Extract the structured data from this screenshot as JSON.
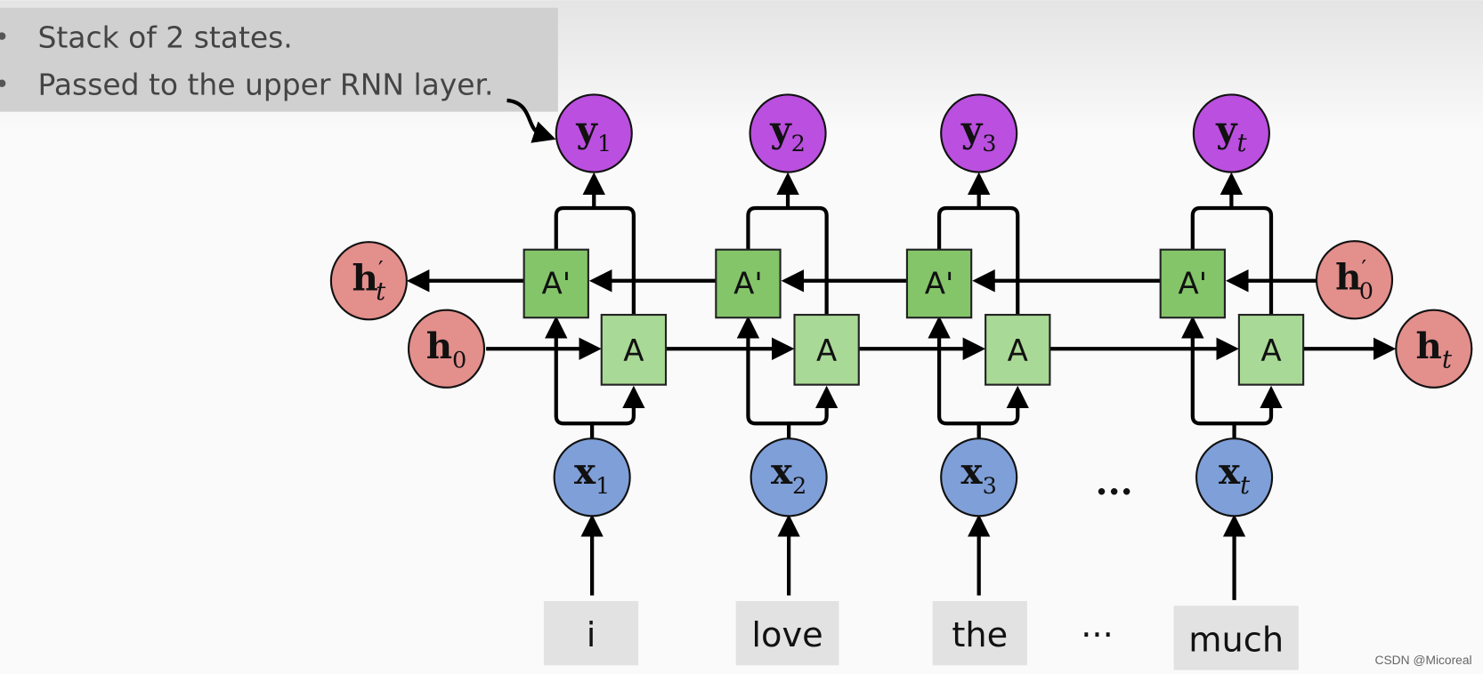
{
  "bullets": [
    "Stack of 2 states.",
    "Passed to the upper RNN layer."
  ],
  "outputs": [
    {
      "sym": "y",
      "sub": "1"
    },
    {
      "sym": "y",
      "sub": "2"
    },
    {
      "sym": "y",
      "sub": "3"
    },
    {
      "sym": "y",
      "sub": "t"
    }
  ],
  "inputs": [
    {
      "sym": "x",
      "sub": "1"
    },
    {
      "sym": "x",
      "sub": "2"
    },
    {
      "sym": "x",
      "sub": "3"
    },
    {
      "sym": "x",
      "sub": "t"
    }
  ],
  "backward_cell_label": "A'",
  "forward_cell_label": "A",
  "states": {
    "h_t_prime": {
      "sym": "h",
      "prime": "′",
      "sub": "t"
    },
    "h_0": {
      "sym": "h",
      "sub": "0"
    },
    "h_0_prime": {
      "sym": "h",
      "prime": "′",
      "sub": "0"
    },
    "h_t": {
      "sym": "h",
      "sub": "t"
    }
  },
  "words": [
    "i",
    "love",
    "the",
    "much"
  ],
  "ellipsis": "...",
  "word_ellipsis": "···",
  "watermark": "CSDN @Micoreal",
  "colors": {
    "output": "#bb4fe0",
    "input": "#7f9fd8",
    "state": "#e38f8c",
    "backward_cell": "#84c56a",
    "forward_cell": "#a9d996",
    "word_box": "#e2e2e2",
    "text_panel": "#cfcfcf"
  }
}
